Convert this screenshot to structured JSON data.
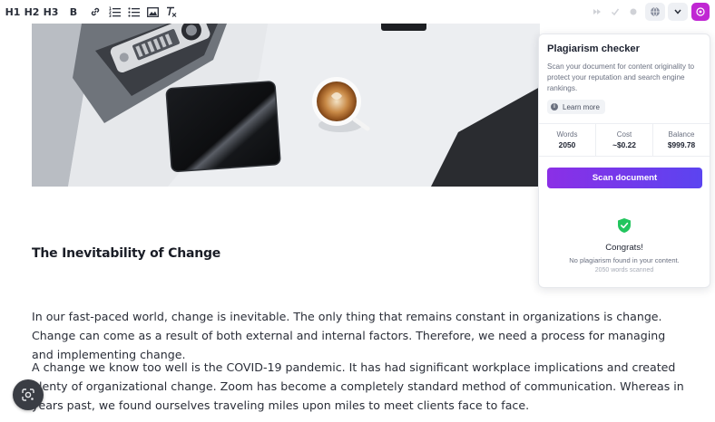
{
  "toolbar": {
    "h1": "H1",
    "h2": "H2",
    "h3": "H3",
    "bold": "B"
  },
  "article": {
    "heading": "The Inevitability of Change",
    "paragraph_1": "In our fast-paced world, change is inevitable. The only thing that remains constant in organizations is change. Change can come as a result of both external and internal factors. Therefore, we need a process for managing and implementing change.",
    "paragraph_2": "A change we know too well is the COVID-19 pandemic. It has had significant workplace implications and created plenty of organizational change. Zoom has become a completely standard method of communication. Whereas in years past, we found ourselves traveling miles upon miles to meet clients face to face."
  },
  "panel": {
    "title": "Plagiarism checker",
    "description": "Scan your document for content originality to protect your reputation and search engine rankings.",
    "learn_more": "Learn more",
    "stats": [
      {
        "label": "Words",
        "value": "2050"
      },
      {
        "label": "Cost",
        "value": "~$0.22"
      },
      {
        "label": "Balance",
        "value": "$999.78"
      }
    ],
    "scan_button": "Scan document",
    "congrats": "Congrats!",
    "result": "No plagiarism found in your content.",
    "words_scanned": "2050 words scanned"
  },
  "colors": {
    "accent_purple": "#c026d3",
    "button_gradient_start": "#8b2fe6",
    "button_gradient_end": "#5b44f0",
    "success_green": "#22c55e"
  },
  "icons": [
    "link-icon",
    "ordered-list-icon",
    "bullet-list-icon",
    "image-icon",
    "clear-format-icon",
    "redo-icon",
    "check-icon",
    "circle-icon",
    "globe-icon",
    "chevron-down-icon",
    "plagiarism-icon",
    "info-icon",
    "shield-check-icon",
    "lens-icon"
  ]
}
